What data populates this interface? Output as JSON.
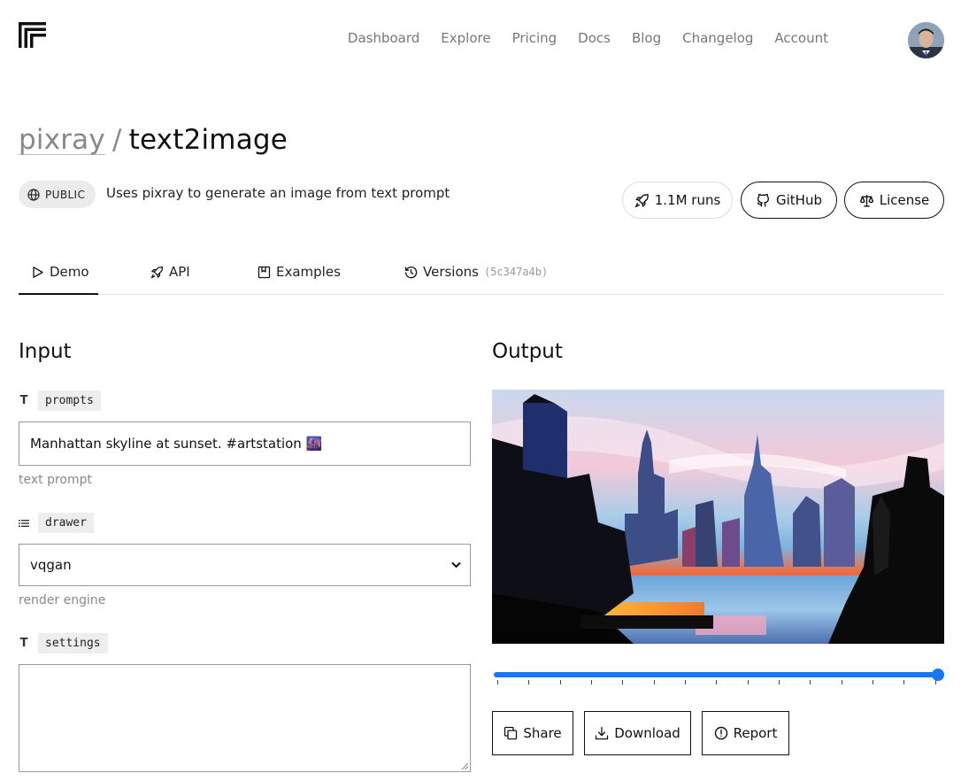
{
  "nav": {
    "items": [
      "Dashboard",
      "Explore",
      "Pricing",
      "Docs",
      "Blog",
      "Changelog",
      "Account"
    ]
  },
  "model": {
    "owner": "pixray",
    "separator": "/",
    "name": "text2image",
    "visibility": "PUBLIC",
    "description": "Uses pixray to generate an image from text prompt",
    "runs_label": "1.1M runs",
    "github_label": "GitHub",
    "license_label": "License"
  },
  "tabs": {
    "demo": "Demo",
    "api": "API",
    "examples": "Examples",
    "versions": "Versions",
    "version_hash": "(5c347a4b)"
  },
  "input": {
    "heading": "Input",
    "prompts": {
      "name": "prompts",
      "value": "Manhattan skyline at sunset. #artstation 🌆",
      "help": "text prompt"
    },
    "drawer": {
      "name": "drawer",
      "value": "vqgan",
      "help": "render engine"
    },
    "settings": {
      "name": "settings",
      "value": ""
    }
  },
  "output": {
    "heading": "Output",
    "progress": 1.0,
    "share_label": "Share",
    "download_label": "Download",
    "report_label": "Report"
  },
  "colors": {
    "accent": "#1976f2",
    "text": "#111111",
    "muted": "#888888"
  }
}
